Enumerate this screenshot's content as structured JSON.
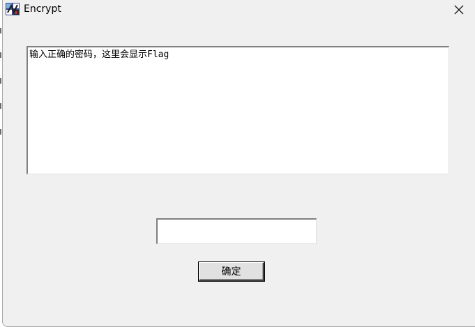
{
  "window": {
    "title": "Encrypt",
    "icon": "app-icon",
    "close_icon": "close-icon"
  },
  "output": {
    "text": "输入正确的密码，这里会显示Flag"
  },
  "password": {
    "value": "",
    "placeholder": ""
  },
  "buttons": {
    "ok_label": "确定"
  },
  "colors": {
    "window_bg": "#f0f0f0",
    "field_bg": "#ffffff",
    "button_bg": "#e1e1e1",
    "text": "#000000"
  }
}
